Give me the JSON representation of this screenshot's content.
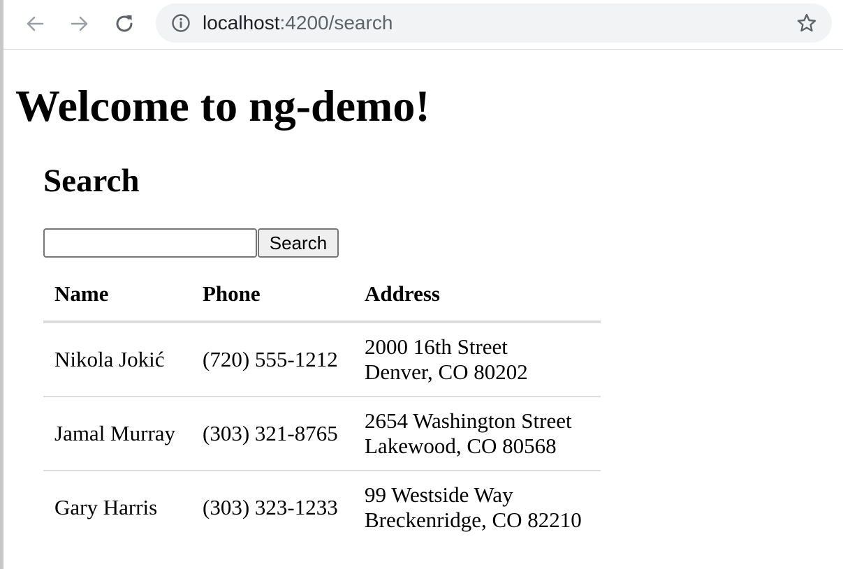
{
  "browser": {
    "url_host": "localhost",
    "url_rest": ":4200/search"
  },
  "icons": {
    "back": "arrow-left-icon",
    "forward": "arrow-right-icon",
    "reload": "reload-icon",
    "site_info": "info-icon",
    "bookmark": "star-icon"
  },
  "app": {
    "title": "Welcome to ng-demo!"
  },
  "search": {
    "heading": "Search",
    "query": "",
    "button_label": "Search"
  },
  "table": {
    "columns": [
      "Name",
      "Phone",
      "Address"
    ],
    "rows": [
      {
        "name": "Nikola Jokić",
        "phone": "(720) 555-1212",
        "address_line1": "2000 16th Street",
        "address_line2": "Denver, CO 80202"
      },
      {
        "name": "Jamal Murray",
        "phone": "(303) 321-8765",
        "address_line1": "2654 Washington Street",
        "address_line2": "Lakewood, CO 80568"
      },
      {
        "name": "Gary Harris",
        "phone": "(303) 323-1233",
        "address_line1": "99 Westside Way",
        "address_line2": "Breckenridge, CO 82210"
      }
    ]
  },
  "colors": {
    "omnibox_bg": "#f1f3f4",
    "icon_gray": "#5f6368",
    "table_border": "#dddddd"
  }
}
